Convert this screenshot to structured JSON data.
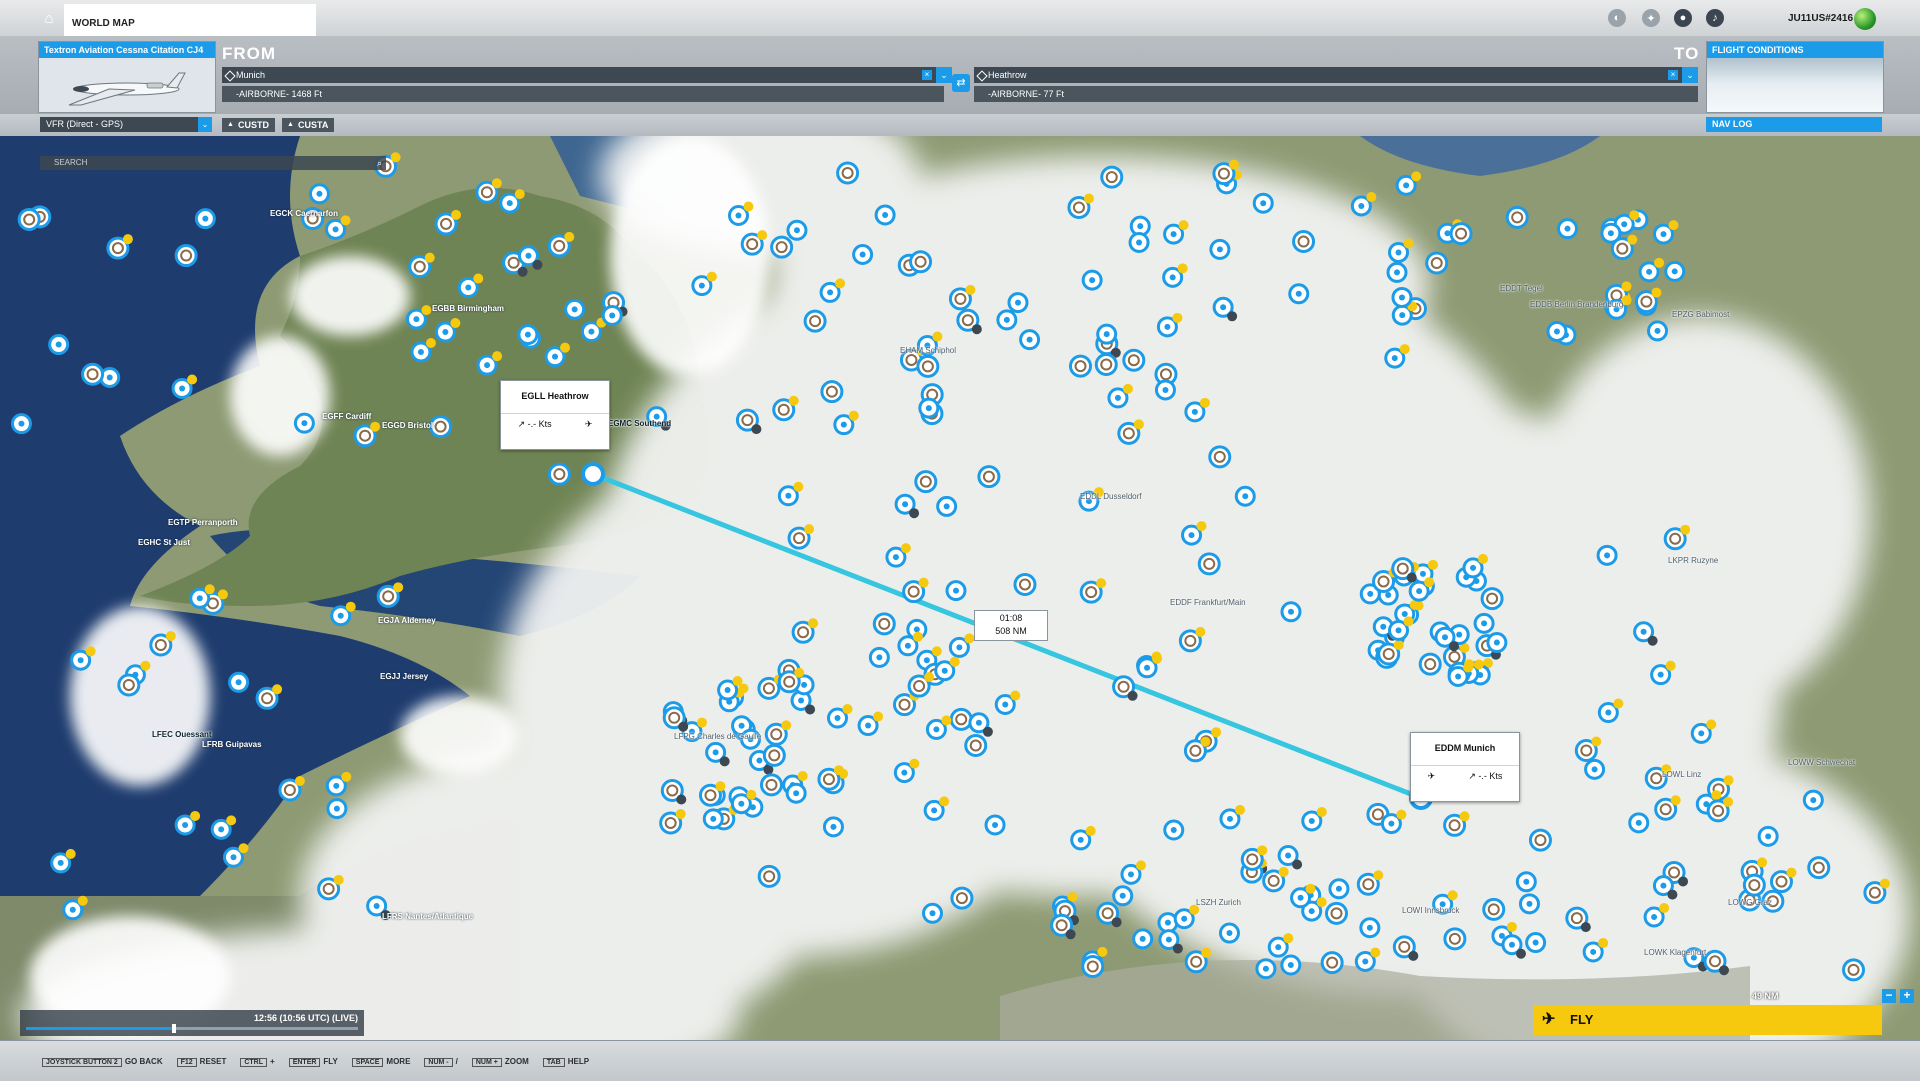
{
  "topbar": {
    "tab_label": "WORLD MAP",
    "user_name": "JU11US#2416"
  },
  "aircraft": {
    "title": "Textron Aviation Cessna Citation CJ4"
  },
  "flight": {
    "from_label": "FROM",
    "to_label": "TO",
    "from_airport": "Munich",
    "from_altitude": "-AIRBORNE- 1468 Ft",
    "to_airport": "Heathrow",
    "to_altitude": "-AIRBORNE- 77 Ft"
  },
  "conditions": {
    "title": "FLIGHT CONDITIONS"
  },
  "options": {
    "route_type": "VFR (Direct - GPS)",
    "custd": "CUSTD",
    "custa": "CUSTA",
    "nav_log": "NAV LOG"
  },
  "map": {
    "search_placeholder": "SEARCH",
    "route_time": "01:08",
    "route_distance": "508 NM",
    "origin_popup": {
      "title": "EGLL Heathrow",
      "speed": "-.- Kts"
    },
    "dest_popup": {
      "title": "EDDM Munich",
      "speed": "-.- Kts"
    },
    "labels": [
      {
        "text": "EGCK Caernarfon"
      },
      {
        "text": "EGBB Birmingham"
      },
      {
        "text": "EGFF Cardiff"
      },
      {
        "text": "EGGD Bristol"
      },
      {
        "text": "EGMC Southend"
      },
      {
        "text": "EGTP Perranporth"
      },
      {
        "text": "EGHC St Just"
      },
      {
        "text": "EGJA Alderney"
      },
      {
        "text": "EGJJ Jersey"
      },
      {
        "text": "LFEC Ouessant"
      },
      {
        "text": "LFRB Guipavas"
      },
      {
        "text": "LFRS Nantes/Atlantique"
      },
      {
        "text": "EHAM Schiphol"
      },
      {
        "text": "EDDF Frankfurt/Main"
      },
      {
        "text": "EDDT Tegel"
      },
      {
        "text": "EDDB Berlin Brandenburg"
      },
      {
        "text": "EPZG Babimost"
      },
      {
        "text": "LKPR Ruzyne"
      },
      {
        "text": "LOWW Schwechat"
      },
      {
        "text": "LOWL Linz"
      },
      {
        "text": "LOWI Innsbruck"
      },
      {
        "text": "LOWG Graz"
      },
      {
        "text": "LOWK Klagenfurt"
      },
      {
        "text": "LSZH Zurich"
      },
      {
        "text": "LFPG Charles de Gaulle"
      },
      {
        "text": "EDDL Dusseldorf"
      }
    ],
    "time_display": "12:56 (10:56 UTC) (LIVE)",
    "time_fraction": 0.44,
    "scale": "49 NM"
  },
  "fly_label": "FLY",
  "hints": [
    {
      "key": "JOYSTICK BUTTON 2",
      "action": "GO BACK"
    },
    {
      "key": "F12",
      "action": "RESET"
    },
    {
      "key": "CTRL",
      "action": "+"
    },
    {
      "key": "ENTER",
      "action": "FLY"
    },
    {
      "key": "SPACE",
      "action": "MORE"
    },
    {
      "key": "NUM -",
      "action": "/"
    },
    {
      "key": "NUM +",
      "action": "ZOOM"
    },
    {
      "key": "TAB",
      "action": "HELP"
    }
  ],
  "colors": {
    "accent": "#1c9be8",
    "fly": "#f6c90f",
    "route": "#36c6e0",
    "warning": "#f6c90f"
  }
}
